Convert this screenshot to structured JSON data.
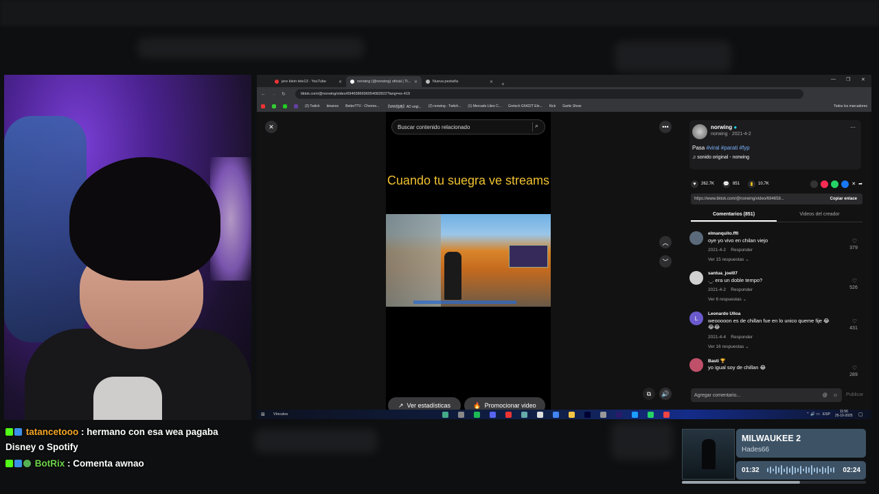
{
  "browser": {
    "tabs": [
      {
        "label": "jere klein tele13 - YouTube",
        "active": false
      },
      {
        "label": "norwing (@norwing) oficial | Ti...",
        "active": true
      },
      {
        "label": "Nueva pestaña",
        "active": false
      }
    ],
    "url": "tiktok.com/@norwing/video/6946586696054082822?lang=es-419",
    "bookmarks": [
      "(2) Twitch",
      "binance",
      "BetterTTV - Chrome...",
      "【WW指南】AD origi...",
      "(2) norwing - Twitch...",
      "(1) Mercado Libre C...",
      "Gretsch G5422T Ele...",
      "Kick",
      "Gartic Show",
      "Todos los marcadores"
    ]
  },
  "tiktok": {
    "search_placeholder": "Buscar contenido relacionado",
    "caption": "Cuando tu suegra ve streams",
    "buttons": {
      "stats": "Ver estadísticas",
      "promote": "Promocionar video"
    },
    "author": {
      "name": "norwing",
      "sub": "norwing · 2021-4-2"
    },
    "description_prefix": "Pasa",
    "hashtags": "#viral #parati #fyp",
    "sound": "sonido original - norwing",
    "counts": {
      "likes": "262.7K",
      "comments": "851",
      "saves": "10.7K"
    },
    "link": "https://www.tiktok.com/@norwing/video/694658...",
    "copy_link": "Copiar enlace",
    "tabs": {
      "comments": "Comentarios (851)",
      "creator": "Videos del creador"
    },
    "reply_label": "Responder",
    "comments": [
      {
        "user": "elmanquito.ff0",
        "text": "oye yo vivo en chilan viejo",
        "date": "2021-4-2",
        "replies": "Ver 15 respuestas",
        "likes": "379",
        "avatar_color": "#5a6a7a"
      },
      {
        "user": "santua_joel07",
        "text": "._. era un doble tempo?",
        "date": "2021-4-2",
        "replies": "Ver 6 respuestas",
        "likes": "526",
        "avatar_color": "#d0d0d0"
      },
      {
        "user": "Leonardo Ulloa",
        "text": "weooooon es de chillan fue en lo unico queme fije 😂😂😂",
        "date": "2021-4-4",
        "replies": "Ver 16 respuestas",
        "likes": "431",
        "avatar_color": "#6a5acd"
      },
      {
        "user": "Basti 🏆",
        "text": "yo igual soy de chillan 😂",
        "date": "",
        "replies": "",
        "likes": "289",
        "avatar_color": "#c0506a"
      }
    ],
    "add_comment": "Agregar comentario...",
    "publish": "Publicar"
  },
  "taskbar": {
    "links": "Vínculos",
    "lang": "ESP",
    "time": "11:56",
    "date": "25-10-2025"
  },
  "chat": [
    {
      "user": "tatancetooo",
      "message": "hermano con esa wea pagaba",
      "cont": "Disney o Spotify"
    },
    {
      "user": "BotRix",
      "message": "Comenta awnao"
    }
  ],
  "now_playing": {
    "title": "MILWAUKEE 2",
    "artist": "Hades66",
    "current": "01:32",
    "total": "02:24",
    "progress": 0.64
  }
}
